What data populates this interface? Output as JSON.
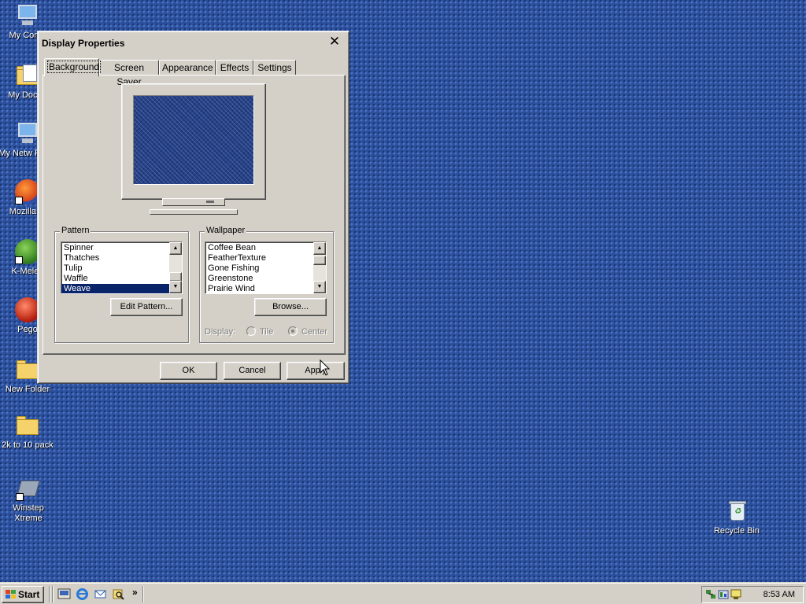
{
  "desktop": {
    "icons": [
      {
        "label": "My Comp"
      },
      {
        "label": "My Docun"
      },
      {
        "label": "My Netw Place"
      },
      {
        "label": "Mozilla Fi"
      },
      {
        "label": "K-Meleo"
      },
      {
        "label": "Pego"
      },
      {
        "label": "New Folder"
      },
      {
        "label": "2k to 10 pack"
      },
      {
        "label": "Winstep Xtreme"
      },
      {
        "label": "Recycle Bin"
      }
    ]
  },
  "window": {
    "title": "Display Properties",
    "close_glyph": "✕",
    "tabs": [
      "Background",
      "Screen Saver",
      "Appearance",
      "Effects",
      "Settings"
    ],
    "active_tab": "Background",
    "pattern": {
      "label": "Pattern",
      "items": [
        "Spinner",
        "Thatches",
        "Tulip",
        "Waffle",
        "Weave"
      ],
      "selected": "Weave",
      "edit_button": "Edit Pattern..."
    },
    "wallpaper": {
      "label": "Wallpaper",
      "items": [
        "Coffee Bean",
        "FeatherTexture",
        "Gone Fishing",
        "Greenstone",
        "Prairie Wind"
      ],
      "browse_button": "Browse...",
      "display_label": "Display:",
      "options": [
        "Tile",
        "Center"
      ],
      "selected_option": "Center"
    },
    "buttons": {
      "ok": "OK",
      "cancel": "Cancel",
      "apply": "Apply"
    }
  },
  "taskbar": {
    "start_label": "Start",
    "quick_launch_more": "»",
    "clock": "8:53 AM"
  },
  "colors": {
    "desktop": "#2b4f9a",
    "selection": "#0a246a",
    "face": "#d4d0c8"
  }
}
